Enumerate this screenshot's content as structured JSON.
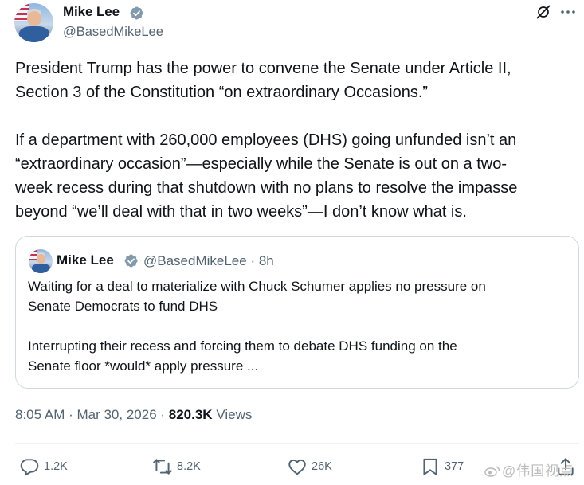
{
  "author": {
    "name": "Mike Lee",
    "handle": "@BasedMikeLee"
  },
  "tweet": {
    "lines_para1": [
      "President Trump has the power to convene the Senate under Article II,",
      "Section 3 of the Constitution “on extraordinary Occasions.”"
    ],
    "lines_para2": [
      "If a department with 260,000 employees (DHS) going unfunded isn’t an",
      "“extraordinary occasion”—especially while the Senate is out on a two-",
      "week recess during that shutdown with no plans to resolve the impasse",
      "beyond “we’ll deal with that in two weeks”—I don’t know what is."
    ]
  },
  "quote": {
    "name": "Mike Lee",
    "meta": "@BasedMikeLee · 8h",
    "lines_para1": [
      "Waiting for a deal to materialize with Chuck Schumer applies no pressure on",
      "Senate Democrats to fund DHS"
    ],
    "lines_para2": [
      "Interrupting their recess and forcing them to debate DHS funding on the",
      "Senate floor *would* apply pressure ..."
    ]
  },
  "meta": {
    "timestamp": "8:05 AM · Mar 30, 2026 · ",
    "views_count": "820.3K",
    "views_label": " Views"
  },
  "actions": {
    "replies": "1.2K",
    "reposts": "8.2K",
    "likes": "26K",
    "bookmarks": "377"
  },
  "watermark": "@伟国视点",
  "colors": {
    "verified": "#829aab",
    "secondary_text": "#536471",
    "primary_text": "#0f1419",
    "border": "#cfd9de"
  },
  "icons": [
    "verified-badge-icon",
    "grok-icon",
    "more-icon",
    "reply-icon",
    "repost-icon",
    "like-icon",
    "bookmark-icon",
    "share-icon"
  ]
}
